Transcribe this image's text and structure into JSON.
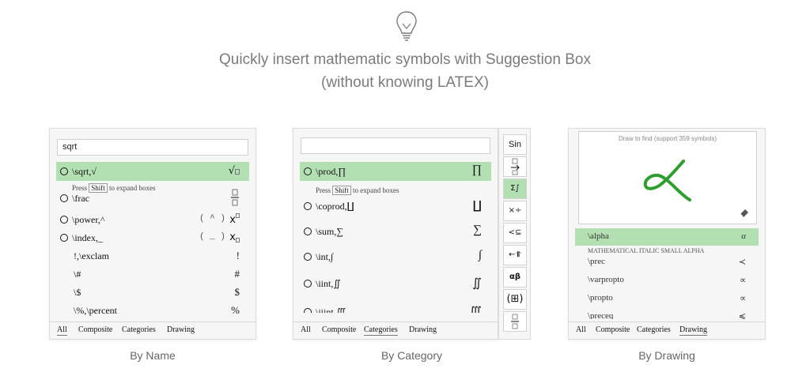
{
  "header": {
    "line1": "Quickly insert mathematic symbols with Suggestion Box",
    "line2": "(without knowing LATEX)"
  },
  "panels": {
    "by_name": {
      "caption": "By Name",
      "search_value": "sqrt",
      "press_hint": {
        "prefix": "Press",
        "key": "Shift",
        "suffix": "to expand boxes"
      },
      "items": [
        {
          "label": "\\sqrt,√",
          "symbol": "√□"
        },
        {
          "label": "\\frac",
          "symbol": "frac-box"
        },
        {
          "label": "\\power,^",
          "hint": "( ^ )",
          "symbol": "x□"
        },
        {
          "label": "\\index,_",
          "hint": "( _ )",
          "symbol": "x□"
        },
        {
          "label": "!,\\exclam",
          "symbol": "!"
        },
        {
          "label": "\\#",
          "symbol": "#"
        },
        {
          "label": "\\$",
          "symbol": "$"
        },
        {
          "label": "\\%,\\percent",
          "symbol": "%"
        }
      ],
      "tabs": [
        "All",
        "Composite",
        "Categories",
        "Drawing"
      ],
      "active_tab": "All"
    },
    "by_category": {
      "caption": "By Category",
      "search_value": "",
      "press_hint": {
        "prefix": "Press",
        "key": "Shift",
        "suffix": "to expand boxes"
      },
      "items": [
        {
          "label": "\\prod,∏",
          "symbol": "∏"
        },
        {
          "label": "\\coprod,∐",
          "symbol": "∐"
        },
        {
          "label": "\\sum,∑",
          "symbol": "∑"
        },
        {
          "label": "\\int,∫",
          "symbol": "∫"
        },
        {
          "label": "\\iint,∬",
          "symbol": "∬"
        },
        {
          "label": "\\iiint,∭",
          "symbol": "∭"
        }
      ],
      "tabs": [
        "All",
        "Composite",
        "Categories",
        "Drawing"
      ],
      "active_tab": "Categories",
      "category_buttons": [
        {
          "name": "functions",
          "label": "Sin"
        },
        {
          "name": "arrows",
          "label": "→"
        },
        {
          "name": "big-operators",
          "label": "Σ∫"
        },
        {
          "name": "operators",
          "label": "×÷"
        },
        {
          "name": "relations",
          "label": "<⊆"
        },
        {
          "name": "arrows-2",
          "label": "←⥣"
        },
        {
          "name": "greek",
          "label": "αβ"
        },
        {
          "name": "matrix",
          "label": "(⊞)"
        },
        {
          "name": "fraction",
          "label": "⊟"
        }
      ]
    },
    "by_drawing": {
      "caption": "By Drawing",
      "draw_hint": "Draw to find (support 359 symbols)",
      "items": [
        {
          "label": "\\alpha",
          "symbol": "α",
          "note": "MATHEMATICAL ITALIC SMALL ALPHA"
        },
        {
          "label": "\\prec",
          "symbol": "≺"
        },
        {
          "label": "\\varpropto",
          "symbol": "∝"
        },
        {
          "label": "\\propto",
          "symbol": "∝"
        },
        {
          "label": "\\preceq",
          "symbol": "≼"
        }
      ],
      "tabs": [
        "All",
        "Composite",
        "Categories",
        "Drawing"
      ],
      "active_tab": "Drawing"
    }
  }
}
